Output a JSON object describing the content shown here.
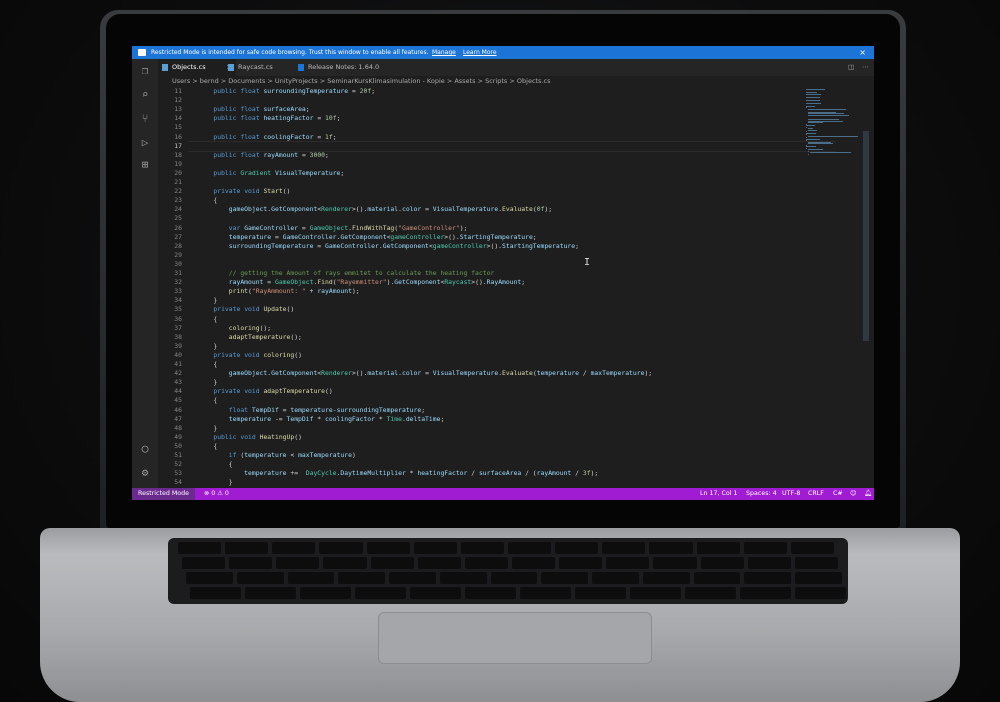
{
  "banner": {
    "message": "Restricted Mode is intended for safe code browsing. Trust this window to enable all features.",
    "manage": "Manage",
    "learn_more": "Learn More",
    "close": "×"
  },
  "tabs": [
    {
      "label": "Objects.cs",
      "active": true
    },
    {
      "label": "Raycast.cs",
      "active": false
    },
    {
      "label": "Release Notes: 1.64.0",
      "active": false
    }
  ],
  "breadcrumb": "Users > bernd > Documents > UnityProjects > SeminarKursKlimasimulation - Kopie > Assets > Scripts > Objects.cs",
  "editor": {
    "current_line": 17,
    "lines": [
      {
        "n": "11",
        "t": "    public float surroundingTemperature = 20f;"
      },
      {
        "n": "12",
        "t": ""
      },
      {
        "n": "13",
        "t": "    public float surfaceArea;"
      },
      {
        "n": "14",
        "t": "    public float heatingFactor = 10f;"
      },
      {
        "n": "15",
        "t": ""
      },
      {
        "n": "16",
        "t": "    public float coolingFactor = 1f;"
      },
      {
        "n": "17",
        "t": ""
      },
      {
        "n": "18",
        "t": "    public float rayAmount = 3000;"
      },
      {
        "n": "19",
        "t": ""
      },
      {
        "n": "20",
        "t": "    public Gradient VisualTemperature;"
      },
      {
        "n": "21",
        "t": ""
      },
      {
        "n": "22",
        "t": "    private void Start()"
      },
      {
        "n": "23",
        "t": "    {"
      },
      {
        "n": "24",
        "t": "        gameObject.GetComponent<Renderer>().material.color = VisualTemperature.Evaluate(0f);"
      },
      {
        "n": "25",
        "t": ""
      },
      {
        "n": "26",
        "t": "        var GameController = GameObject.FindWithTag(\"GameController\");"
      },
      {
        "n": "27",
        "t": "        temperature = GameController.GetComponent<gameController>().StartingTemperature;"
      },
      {
        "n": "28",
        "t": "        surroundingTemperature = GameController.GetComponent<gameController>().StartingTemperature;"
      },
      {
        "n": "29",
        "t": ""
      },
      {
        "n": "30",
        "t": ""
      },
      {
        "n": "31",
        "t": "        // getting the Amount of rays emmitet to calculate the heating factor"
      },
      {
        "n": "32",
        "t": "        rayAmount = GameObject.Find(\"Rayemmitter\").GetComponent<Raycast>().RayAmount;"
      },
      {
        "n": "33",
        "t": "        print(\"RayAmmount: \" + rayAmount);"
      },
      {
        "n": "34",
        "t": "    }"
      },
      {
        "n": "35",
        "t": "    private void Update()"
      },
      {
        "n": "36",
        "t": "    {"
      },
      {
        "n": "37",
        "t": "        coloring();"
      },
      {
        "n": "38",
        "t": "        adaptTemperature();"
      },
      {
        "n": "39",
        "t": "    }"
      },
      {
        "n": "40",
        "t": "    private void coloring()"
      },
      {
        "n": "41",
        "t": "    {"
      },
      {
        "n": "42",
        "t": "        gameObject.GetComponent<Renderer>().material.color = VisualTemperature.Evaluate(temperature / maxTemperature);"
      },
      {
        "n": "43",
        "t": "    }"
      },
      {
        "n": "44",
        "t": "    private void adaptTemperature()"
      },
      {
        "n": "45",
        "t": "    {"
      },
      {
        "n": "46",
        "t": "        float TempDif = temperature-surroundingTemperature;"
      },
      {
        "n": "47",
        "t": "        temperature -= TempDif * coolingFactor * Time.deltaTime;"
      },
      {
        "n": "48",
        "t": "    }"
      },
      {
        "n": "49",
        "t": "    public void HeatingUp()"
      },
      {
        "n": "50",
        "t": "    {"
      },
      {
        "n": "51",
        "t": "        if (temperature < maxTemperature)"
      },
      {
        "n": "52",
        "t": "        {"
      },
      {
        "n": "53",
        "t": "            temperature +=  DayCycle.DaytimeMultiplier * heatingFactor / surfaceArea / (rayAmount / 3f);"
      },
      {
        "n": "54",
        "t": "        }"
      }
    ]
  },
  "statusbar": {
    "restricted": "Restricted Mode",
    "problems": "⊗ 0 ⚠ 0",
    "position": "Ln 17, Col 1",
    "spaces": "Spaces: 4",
    "encoding": "UTF-8",
    "eol": "CRLF",
    "language": "C#"
  },
  "colors": {
    "banner": "#1b74d6",
    "statusbar": "#a01cd2",
    "editor_bg": "#1e1e1e",
    "keyword": "#569cd6",
    "type": "#4ec9b0",
    "string": "#ce9178",
    "comment": "#6a9955",
    "number": "#b5cea8",
    "method": "#dcdcaa"
  },
  "icons": {
    "activity": [
      "explorer-icon",
      "search-icon",
      "source-control-icon",
      "run-debug-icon",
      "extensions-icon",
      "account-icon",
      "settings-gear-icon"
    ]
  }
}
